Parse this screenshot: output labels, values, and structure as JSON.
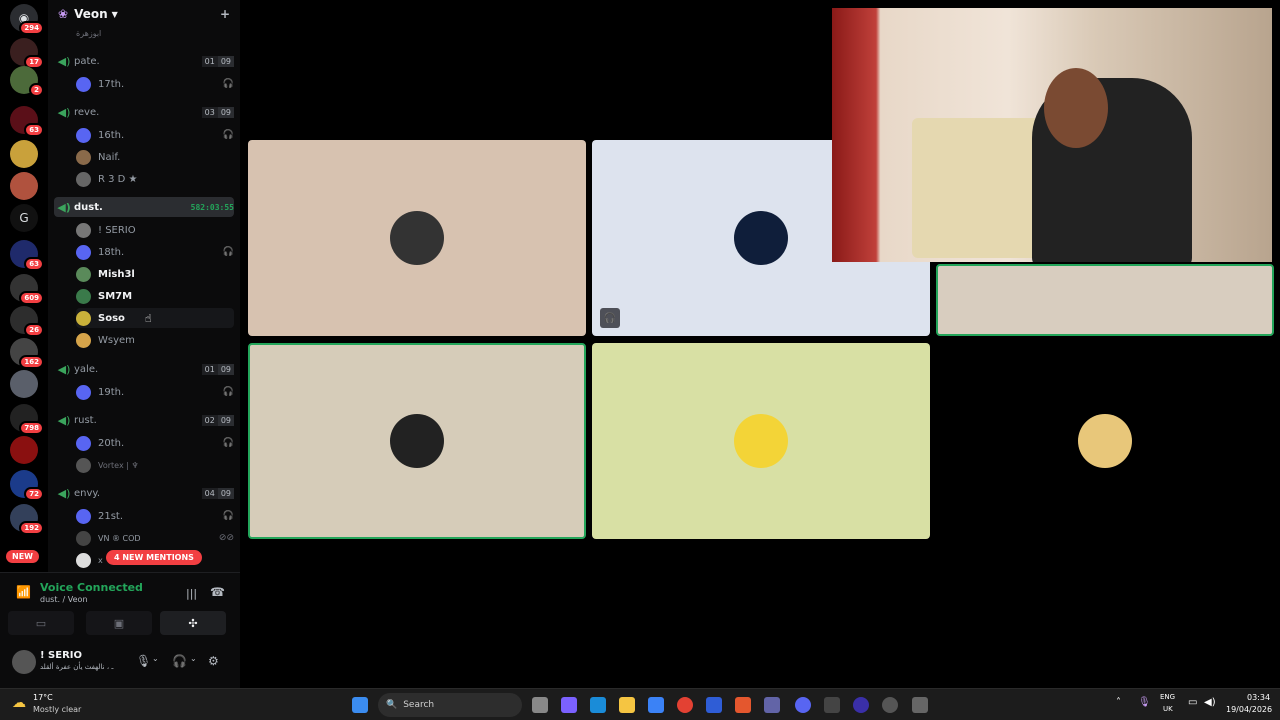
{
  "server": {
    "name": "Veon",
    "chevron": "chevron-down-icon",
    "add_icon": "add-user-icon"
  },
  "rail": {
    "badges": [
      "294",
      "17",
      "2",
      "63",
      "63",
      "609",
      "26",
      "162",
      "798",
      "72",
      "192"
    ],
    "letter": "G",
    "new_label": "NEW"
  },
  "channels": {
    "top_user": "ابوزهرة",
    "items": [
      {
        "name": "pate.",
        "count": "01",
        "limit": "09",
        "users": [
          {
            "name": "17th.",
            "muted": true
          }
        ]
      },
      {
        "name": "reve.",
        "count": "03",
        "limit": "09",
        "users": [
          {
            "name": "16th.",
            "muted": true
          },
          {
            "name": "Naif.",
            "muted": false
          },
          {
            "name": "R 3 D ★",
            "muted": false
          }
        ]
      },
      {
        "name": "dust.",
        "timer": "582:03:55",
        "users": [
          {
            "name": "! SERIO",
            "muted": false
          },
          {
            "name": "18th.",
            "muted": true
          },
          {
            "name": "Mish3l",
            "muted": false
          },
          {
            "name": "SM7M",
            "muted": false
          },
          {
            "name": "Soso",
            "muted": false
          },
          {
            "name": "Wsyem",
            "muted": false
          }
        ]
      },
      {
        "name": "yale.",
        "count": "01",
        "limit": "09",
        "users": [
          {
            "name": "19th.",
            "muted": true
          }
        ]
      },
      {
        "name": "rust.",
        "count": "02",
        "limit": "09",
        "users": [
          {
            "name": "20th.",
            "muted": true
          },
          {
            "name": "Vortex | ♆",
            "muted": false
          }
        ]
      },
      {
        "name": "envy.",
        "count": "04",
        "limit": "09",
        "users": [
          {
            "name": "21st.",
            "muted": true
          },
          {
            "name": "VN ® COD",
            "muted": false
          },
          {
            "name": "x",
            "muted": false
          }
        ]
      }
    ],
    "mentions": "4 NEW MENTIONS"
  },
  "voice": {
    "status": "Voice Connected",
    "location": "dust. / Veon"
  },
  "user": {
    "name": "! SERIO",
    "status": "ـ ، نالهفث یأن عفرة ألقلد"
  },
  "tiles": {
    "colors": [
      "#d7c2b0",
      "#dde3ee",
      "#d8cdbf",
      "#d6ccb9",
      "#d8e0a4",
      "#000000"
    ]
  },
  "taskbar": {
    "weather_temp": "17°C",
    "weather_desc": "Mostly clear",
    "search_label": "Search",
    "lang": "ENG",
    "region": "UK",
    "time": "03:34",
    "date": "19/04/2026"
  }
}
